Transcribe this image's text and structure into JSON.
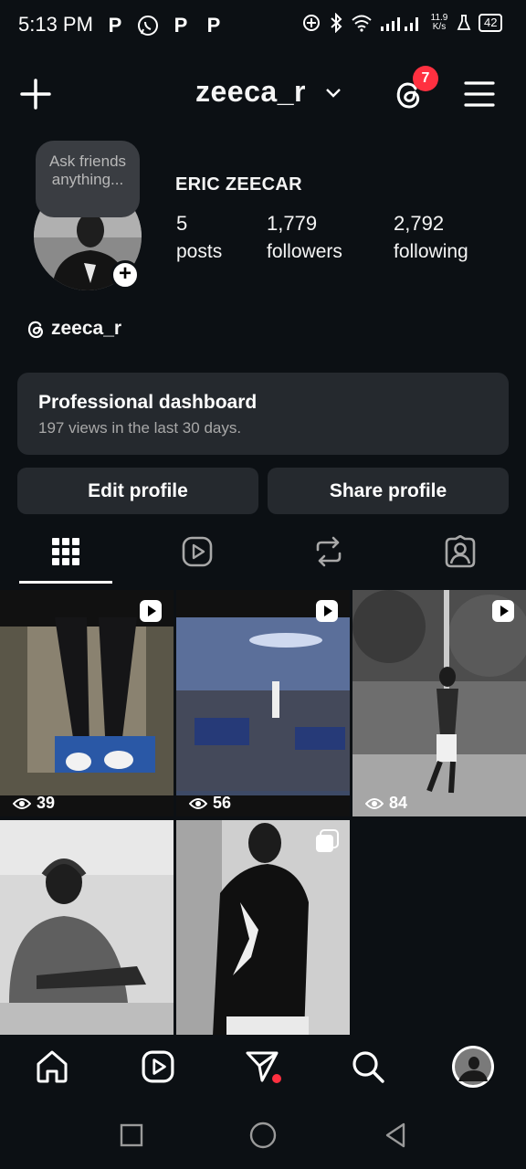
{
  "status_bar": {
    "time": "5:13 PM",
    "app_icons": [
      "P",
      "whatsapp-icon",
      "P",
      "P"
    ],
    "net_speed_top": "11.9",
    "net_speed_bottom": "K/s",
    "battery": "42"
  },
  "header": {
    "username": "zeeca_r",
    "notification_count": "7"
  },
  "profile": {
    "note_text": "Ask friends anything...",
    "display_name": "ERIC ZEECAR",
    "stats": [
      {
        "value": "5",
        "label": "posts"
      },
      {
        "value": "1,779",
        "label": "followers"
      },
      {
        "value": "2,792",
        "label": "following"
      }
    ],
    "threads_handle": "zeeca_r"
  },
  "dashboard": {
    "title": "Professional dashboard",
    "subtitle": "197 views in the last 30 days."
  },
  "buttons": {
    "edit": "Edit profile",
    "share": "Share profile"
  },
  "tabs": [
    "grid-icon",
    "reels-icon",
    "reposts-icon",
    "tagged-icon"
  ],
  "grid": [
    {
      "views": "39",
      "type": "reel"
    },
    {
      "views": "56",
      "type": "reel"
    },
    {
      "views": "84",
      "type": "reel"
    },
    {
      "views": "",
      "type": "photo"
    },
    {
      "views": "",
      "type": "carousel"
    }
  ],
  "colors": {
    "background": "#0c1014",
    "card": "#25292e",
    "badge": "#ff3040",
    "muted_text": "#a8a8a8"
  }
}
